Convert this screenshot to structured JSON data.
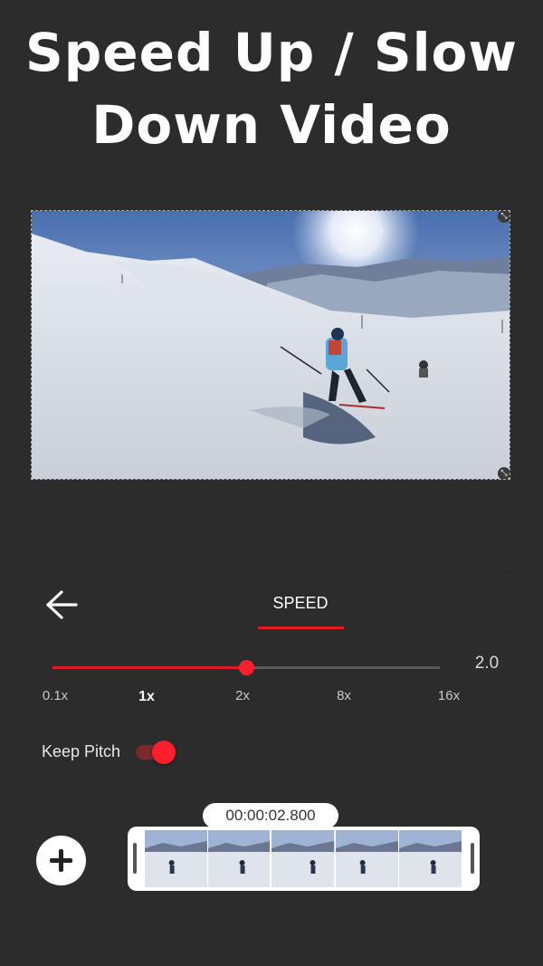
{
  "headline": {
    "line1": "Speed Up / Slow",
    "line2": "Down Video"
  },
  "video": {
    "content": "skier on snowy mountain slope"
  },
  "toolbar": {
    "tab_label": "SPEED"
  },
  "speed": {
    "value_label": "2.0",
    "position_fraction": 0.5,
    "ticks": [
      "0.1x",
      "1x",
      "2x",
      "8x",
      "16x"
    ],
    "selected_tick": "1x"
  },
  "keep_pitch": {
    "label": "Keep Pitch",
    "enabled": true
  },
  "timeline": {
    "timestamp": "00:00:02.800",
    "frame_count": 5
  },
  "colors": {
    "accent": "#e31b23",
    "background": "#2c2c2c"
  },
  "icons": {
    "back": "back-arrow-icon",
    "add": "plus-icon"
  }
}
